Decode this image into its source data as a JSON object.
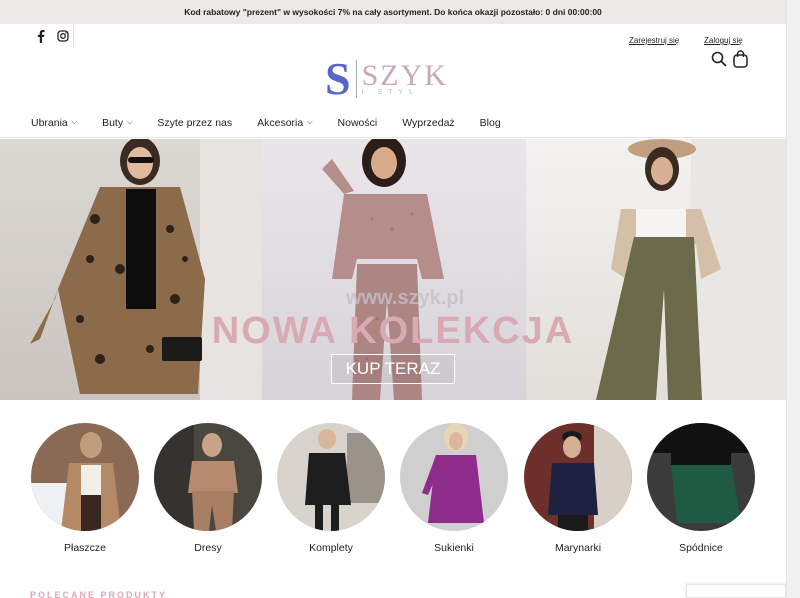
{
  "promo": {
    "text": "Kod rabatowy \"prezent\" w wysokości 7% na cały asortyment. Do końca okazji pozostało:  0 dni 00:00:00"
  },
  "social": {
    "facebook": "f",
    "instagram": "instagram"
  },
  "auth": {
    "register": "Zarejestruj się",
    "login": "Zaloguj się"
  },
  "logo": {
    "mark": "S",
    "word": "SZYK",
    "tagline": "I STYL"
  },
  "nav": [
    {
      "label": "Ubrania",
      "dropdown": true
    },
    {
      "label": "Buty",
      "dropdown": true
    },
    {
      "label": "Szyte przez nas",
      "dropdown": false
    },
    {
      "label": "Akcesoria",
      "dropdown": true
    },
    {
      "label": "Nowości",
      "dropdown": false
    },
    {
      "label": "Wyprzedaż",
      "dropdown": false
    },
    {
      "label": "Blog",
      "dropdown": false
    }
  ],
  "hero": {
    "title": "NOWA KOLEKCJA",
    "button": "KUP TERAZ",
    "watermark": "www.szyk.pl"
  },
  "categories": [
    {
      "label": "Płaszcze",
      "bg": "#8a6a55",
      "fig": "#b48a66",
      "accent": "#f2efe9"
    },
    {
      "label": "Dresy",
      "bg": "#4a4640",
      "fig": "#b58a6e",
      "accent": "#8e6a52"
    },
    {
      "label": "Komplety",
      "bg": "#d8d3cc",
      "fig": "#1e1e1e",
      "accent": "#f3f1ee"
    },
    {
      "label": "Sukienki",
      "bg": "#cfcfcf",
      "fig": "#8e2c8c",
      "accent": "#e7d7b8"
    },
    {
      "label": "Marynarki",
      "bg": "#6c2f2a",
      "fig": "#1c2240",
      "accent": "#d8cfc7"
    },
    {
      "label": "Spódnice",
      "bg": "#3b3b3b",
      "fig": "#1f5a44",
      "accent": "#111111"
    }
  ],
  "section": {
    "recommended": "POLECANE PRODUKTY"
  },
  "colors": {
    "brand": "#5865c8",
    "pink": "#d9aab3",
    "promo_bg": "#ede9e6"
  }
}
